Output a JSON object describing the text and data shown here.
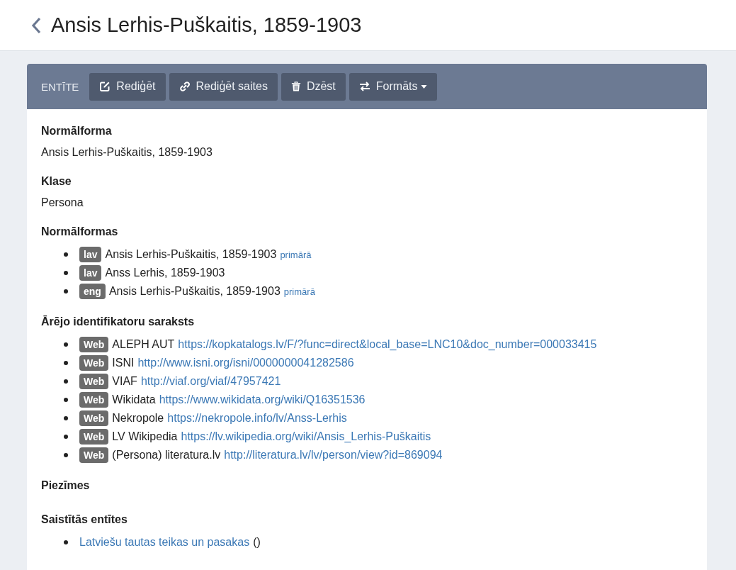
{
  "page": {
    "title": "Ansis Lerhis-Puškaitis, 1859-1903"
  },
  "toolbar": {
    "label": "ENTĪTE",
    "buttons": [
      {
        "label": "Rediģēt",
        "kind": "edit",
        "dropdown": false
      },
      {
        "label": "Rediģēt saites",
        "kind": "link",
        "dropdown": false
      },
      {
        "label": "Dzēst",
        "kind": "delete",
        "dropdown": false
      },
      {
        "label": "Formāts",
        "kind": "format",
        "dropdown": true
      }
    ]
  },
  "sections": [
    {
      "kind": "text",
      "heading": "Normālforma",
      "text": "Ansis Lerhis-Puškaitis, 1859-1903"
    },
    {
      "kind": "text",
      "heading": "Klase",
      "text": "Persona"
    },
    {
      "kind": "forms",
      "heading": "Normālformas",
      "items": [
        {
          "tag": "lav",
          "text": "Ansis Lerhis-Puškaitis, 1859-1903",
          "note": "primārā"
        },
        {
          "tag": "lav",
          "text": "Anss Lerhis, 1859-1903"
        },
        {
          "tag": "eng",
          "text": "Ansis Lerhis-Puškaitis, 1859-1903",
          "note": "primārā"
        }
      ]
    },
    {
      "kind": "identifiers",
      "heading": "Ārējo identifikatoru saraksts",
      "items": [
        {
          "tag": "Web",
          "name": "ALEPH AUT",
          "url": "https://kopkatalogs.lv/F/?func=direct&local_base=LNC10&doc_number=000033415"
        },
        {
          "tag": "Web",
          "name": "ISNI",
          "url": "http://www.isni.org/isni/0000000041282586"
        },
        {
          "tag": "Web",
          "name": "VIAF",
          "url": "http://viaf.org/viaf/47957421"
        },
        {
          "tag": "Web",
          "name": "Wikidata",
          "url": "https://www.wikidata.org/wiki/Q16351536"
        },
        {
          "tag": "Web",
          "name": "Nekropole",
          "url": "https://nekropole.info/lv/Anss-Lerhis"
        },
        {
          "tag": "Web",
          "name": "LV Wikipedia",
          "url": "https://lv.wikipedia.org/wiki/Ansis_Lerhis-Puškaitis"
        },
        {
          "tag": "Web",
          "name": "(Persona) literatura.lv",
          "url": "http://literatura.lv/lv/person/view?id=869094"
        }
      ]
    },
    {
      "kind": "empty",
      "heading": "Piezīmes"
    },
    {
      "kind": "related",
      "heading": "Saistītās entītes",
      "items": [
        {
          "link": "Latviešu tautas teikas un pasakas",
          "suffix": "()"
        }
      ]
    }
  ]
}
